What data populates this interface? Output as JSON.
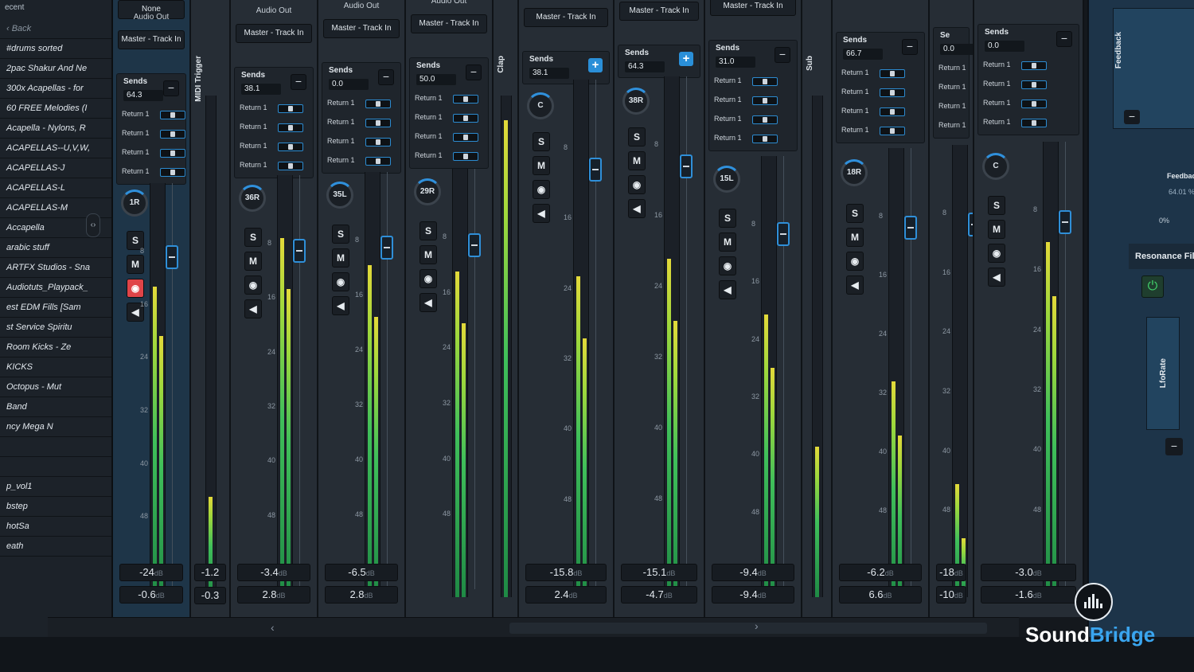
{
  "library": {
    "header": "ecent",
    "back_label": "‹ Back",
    "items": [
      "#drums sorted",
      "2pac Shakur And Ne",
      "300x Acapellas - for",
      "60 FREE Melodies (I",
      "Acapella - Nylons, R",
      "ACAPELLAS--U,V,W,",
      "ACAPELLAS-J",
      "ACAPELLAS-L",
      "ACAPELLAS-M",
      "Accapella",
      "arabic stuff",
      "ARTFX Studios - Sna",
      "Audiotuts_Playpack_",
      "est EDM Fills [Sam",
      "st Service Spiritu",
      "Room Kicks - Ze",
      "KICKS",
      "Octopus - Mut",
      "Band",
      "ncy Mega N",
      "",
      "",
      "p_vol1",
      "bstep",
      "hotSa",
      "eath"
    ]
  },
  "mixer": {
    "strips": [
      {
        "name": "strip-1",
        "io_top": "None",
        "io_label": "Audio Out",
        "io_value": "Master - Track In",
        "sends_value": "64.3",
        "pan": "1R",
        "record_on": true,
        "vol": "-24",
        "vol2": "-0.6",
        "sends": [
          "Return 1",
          "Return 1",
          "Return 1",
          "Return 1"
        ]
      },
      {
        "name": "strip-2",
        "vertical": "MIDI Trigger",
        "vol": "-1.2",
        "vol2": "-0.3"
      },
      {
        "name": "strip-3",
        "io_label": "Audio Out",
        "io_value": "Master - Track In",
        "sends_value": "38.1",
        "pan": "36R",
        "vol": "-3.4",
        "vol2": "2.8",
        "sends": [
          "Return 1",
          "Return 1",
          "Return 1",
          "Return 1"
        ]
      },
      {
        "name": "strip-4",
        "io_label": "Audio Out",
        "io_value": "Master - Track In",
        "sends_value": "0.0",
        "pan": "35L",
        "vol": "-6.5",
        "vol2": "2.8",
        "sends": [
          "Return 1",
          "Return 1",
          "Return 1",
          "Return 1"
        ]
      },
      {
        "name": "strip-5",
        "io_label": "Audio Out",
        "io_value": "Master - Track In",
        "sends_value": "50.0",
        "pan": "29R",
        "sends": [
          "Return 1",
          "Return 1",
          "Return 1",
          "Return 1"
        ]
      },
      {
        "name": "strip-6",
        "vertical": "Clap"
      },
      {
        "name": "strip-7",
        "io_value": "Master - Track In",
        "sends_value": "38.1",
        "pan": "C",
        "vol": "-15.8",
        "vol2": "2.4"
      },
      {
        "name": "strip-8",
        "io_value": "Master - Track In",
        "sends_value": "64.3",
        "pan": "38R",
        "vol": "-15.1",
        "vol2": "-4.7"
      },
      {
        "name": "strip-9",
        "io_value": "Master - Track In",
        "sends_value": "31.0",
        "pan": "15L",
        "vol": "-9.4",
        "vol2": "-9.4",
        "sends": [
          "Return 1",
          "Return 1",
          "Return 1",
          "Return 1"
        ]
      },
      {
        "name": "strip-10",
        "vertical": "Sub"
      },
      {
        "name": "strip-11",
        "sends_value": "66.7",
        "pan": "18R",
        "vol": "-6.2",
        "vol2": "6.6",
        "sends": [
          "Return 1",
          "Return 1",
          "Return 1",
          "Return 1"
        ]
      },
      {
        "name": "strip-12",
        "sends_value": "0.0",
        "vol": "-18",
        "vol2": "-10",
        "sends": [
          "Return 1",
          "Return 1",
          "Return 1",
          "Return 1"
        ]
      },
      {
        "name": "strip-13",
        "sends_value": "0.0",
        "pan": "C",
        "vol": "-3.0",
        "vol2": "-1.6",
        "sends": [
          "Return 1",
          "Return 1",
          "Return 1",
          "Return 1"
        ]
      }
    ],
    "sends_title": "Sends",
    "sends_short": "Se",
    "db_unit": "dB",
    "btn_solo": "S",
    "btn_mute": "M",
    "ticks": [
      "8",
      "16",
      "24",
      "32",
      "40",
      "48"
    ]
  },
  "right_panel": {
    "feedback_vertical": "Feedback",
    "feedback_label": "Feedback",
    "feedback_value": "64.01 %",
    "feedback_min": "0%",
    "resonance": "Resonance Filter",
    "lforate": "LfoRate"
  },
  "brand": {
    "name_a": "Sound",
    "name_b": "Bridge"
  },
  "colors": {
    "accent": "#2f90dc",
    "record": "#e04448",
    "meter_green": "#3fbf5a",
    "meter_yellow": "#e3d93a"
  }
}
